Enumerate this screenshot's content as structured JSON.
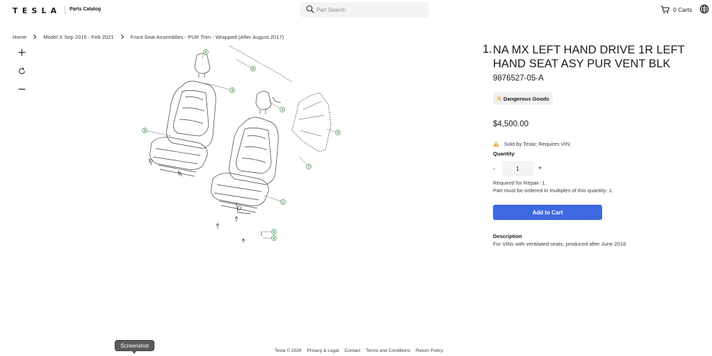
{
  "header": {
    "logo": "TESLA",
    "catalog_label": "Parts Catalog",
    "search_placeholder": "Part Search",
    "cart_label": "0 Carts",
    "cart_icon": "cart-icon",
    "globe_icon": "globe-icon",
    "search_icon": "search-icon"
  },
  "breadcrumb": [
    "Home",
    "Model X Sep 2015 - Feb 2021",
    "Front Seat Assemblies - PUR Trim - Wrapped (After August 2017)"
  ],
  "zoom_controls": [
    "zoom-in-icon",
    "reset-icon",
    "zoom-out-icon"
  ],
  "diagram": {
    "callouts": [
      "1",
      "2",
      "3",
      "4",
      "5",
      "6",
      "7",
      "8",
      "9",
      "3",
      "4"
    ]
  },
  "product": {
    "index": "1.",
    "title": "NA MX LEFT HAND DRIVE 1R LEFT HAND SEAT ASY PUR VENT BLK",
    "part_number": "9876527-05-A",
    "badge": "Dangerous Goods",
    "price": "$4,500.00",
    "sold_note": "Sold by Tesla; Requires VIN",
    "quantity_label": "Quantity",
    "quantity_minus": "-",
    "quantity_value": "1",
    "quantity_plus": "+",
    "required_for_repair": "Required for Repair: 1.",
    "multiples_note": "Part must be ordered in multiples of this quantity: 1.",
    "add_to_cart": "Add to Cart",
    "description_heading": "Description",
    "description": "For VINs with ventilated seats, produced after June 2018"
  },
  "footer": {
    "links": [
      "Tesla © 2026",
      "Privacy & Legal",
      "Contact",
      "Terms and Conditions",
      "Return Policy"
    ]
  },
  "tooltip": "Screenshot",
  "colors": {
    "accent": "#3e6ae1",
    "text": "#171a20",
    "muted": "#393c41",
    "callout_green": "#3f9e4d",
    "warning": "#f5a623"
  }
}
